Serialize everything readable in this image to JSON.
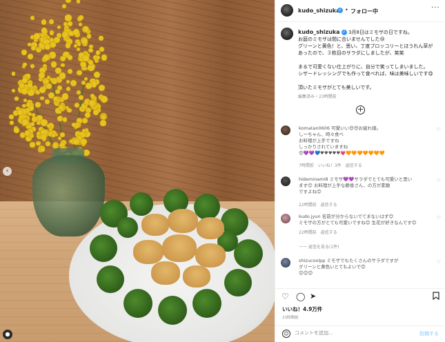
{
  "photo": {
    "subject": "mimosa-and-salad",
    "nav_icon": "chevron-left-icon",
    "avatar_icon": "user-icon"
  },
  "header": {
    "username": "kudo_shizuka",
    "follow_label": "フォロー中",
    "more_icon": "ellipsis-icon"
  },
  "caption": {
    "username": "kudo_shizuka",
    "lines": [
      "3月8日はミモザの日ですね。",
      "お庭のミモザは間に合いませんでした😢",
      "グリーンと黄色！と、思い、丁度ブロッコリーとほうれん草が",
      "あったので、３枚目のサラダにしましたが、笑笑",
      "",
      "まるで可愛くない仕上がりに、自分で笑ってしまいました。",
      "シザードレッシングでも作って食べれば、味は美味しいです😋",
      "",
      "頂いたミモザがとても美しいです。"
    ],
    "meta": "編集済み・23時間前"
  },
  "load_more_icon": "plus-circle-icon",
  "comments": [
    {
      "lines": [
        "komatan0606 可愛いい😍😍お疲れ様。",
        "しーちゃん、時々食べ",
        "お料理が上手ですね",
        "しっかりされていますね",
        "😍💜💜💙♥♥♥♥♥💗🧡🧡🧡🧡🧡🧡🧡"
      ],
      "meta": "7時間前　いいね！3件　返信する"
    },
    {
      "lines": [
        "hideminami8 ミモザ💜💜サラダでとても可愛いと思い",
        "ます😊 お料理が上手な静香さん、の方が素敵",
        "ですよね😊"
      ],
      "meta": "22時間前　返信する"
    },
    {
      "lines": [
        "kudo.jyun 名前が分からないでてまないはず😊",
        "ミモザの方がとても可愛いですね😊 生花が好きなんです😊"
      ],
      "meta": "22時間前　返信する"
    },
    {
      "lines": [
        "shizucoolpp ミモザでもたくさんのサラダですが",
        "グリーンと黄色いとてもよいで😊",
        "😊😊😊"
      ],
      "meta": ""
    }
  ],
  "view_replies": "ーー 返信を見る(1件)",
  "actions": {
    "like_icon": "heart-icon",
    "comment_icon": "comment-icon",
    "share_icon": "paper-plane-icon",
    "save_icon": "bookmark-icon"
  },
  "likes": "いいね！4.9万件",
  "posted": "23時間前",
  "comment_bar": {
    "placeholder": "コメントを追加...",
    "post_label": "投稿する",
    "emoji_icon": "smiley-icon"
  },
  "colors": {
    "verified": "#3897f0",
    "post_disabled": "#b3dbff",
    "mimosa": "#e8c21e",
    "broccoli": "#2f5e1a"
  }
}
